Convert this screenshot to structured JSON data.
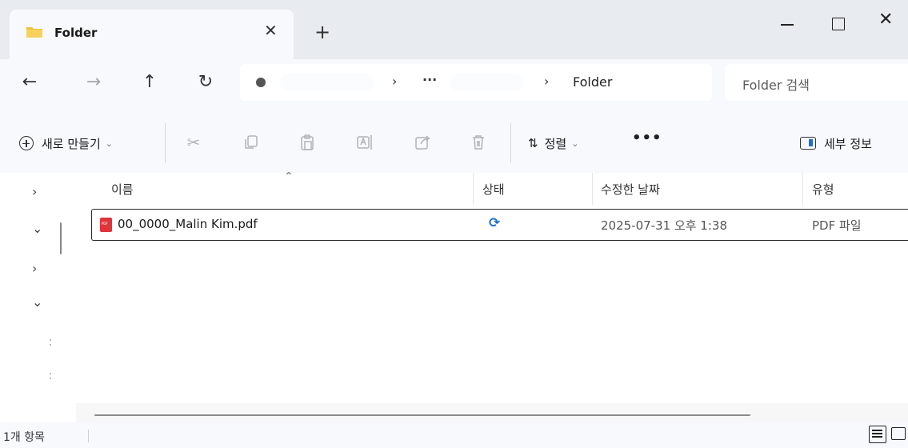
{
  "tab": {
    "title": "Folder",
    "close_glyph": "✕",
    "new_tab_glyph": "+"
  },
  "window": {
    "close_glyph": "✕"
  },
  "nav": {
    "back": "←",
    "forward": "→",
    "up": "↑",
    "refresh": "↻"
  },
  "address": {
    "separator": "›",
    "ellipsis": "···",
    "folder": "Folder"
  },
  "search": {
    "placeholder": "Folder 검색"
  },
  "toolbar": {
    "new_label": "새로 만들기",
    "dropdown_glyph": "⌄",
    "sort_label": "정렬",
    "sort_glyph": "⇅",
    "more_glyph": "•••",
    "details_label": "세부 정보",
    "icons": [
      "cut-icon",
      "copy-icon",
      "paste-icon",
      "rename-icon",
      "share-icon",
      "delete-icon"
    ]
  },
  "navpane": {
    "collapsed_glyph": "›",
    "expanded_glyph": "⌄"
  },
  "columns": {
    "name": "이름",
    "status": "상태",
    "modified": "수정한 날짜",
    "type": "유형",
    "sort_caret": "⌃"
  },
  "files": [
    {
      "name": "00_0000_Malin Kim.pdf",
      "status_glyph": "⟳",
      "modified": "2025-07-31 오후 1:38",
      "type": "PDF 파일"
    }
  ],
  "statusbar": {
    "count": "1개 항목"
  },
  "colors": {
    "accent": "#1f6fd1",
    "pdf_red": "#e0343a",
    "folder_yellow": "#f2c23a"
  }
}
